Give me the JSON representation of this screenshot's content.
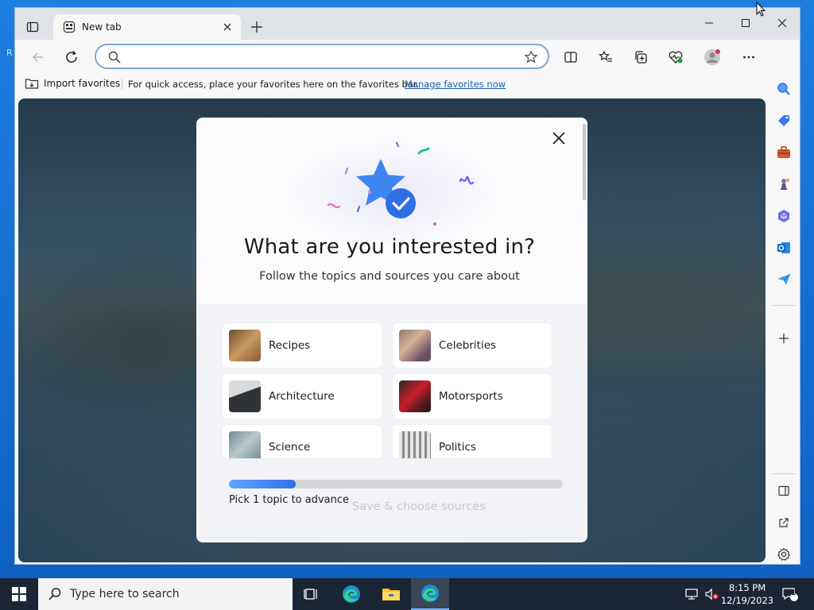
{
  "desktop": {
    "edge_letter": "R"
  },
  "browser": {
    "tab": {
      "title": "New tab"
    },
    "address": {
      "placeholder": "",
      "value": ""
    },
    "favorites_bar": {
      "import_label": "Import favorites",
      "message": "For quick access, place your favorites here on the favorites bar.",
      "manage_link": "Manage favorites now"
    }
  },
  "modal": {
    "title": "What are you interested in?",
    "subtitle": "Follow the topics and sources you care about",
    "topics": [
      {
        "label": "Recipes",
        "thumb_color": "#b08050"
      },
      {
        "label": "Celebrities",
        "thumb_color": "#a08a70"
      },
      {
        "label": "Architecture",
        "thumb_color": "#4a4f55"
      },
      {
        "label": "Motorsports",
        "thumb_color": "#b02028"
      },
      {
        "label": "Science",
        "thumb_color": "#8fa3a8"
      },
      {
        "label": "Politics",
        "thumb_color": "#9a9a9a"
      }
    ],
    "progress": {
      "label": "Pick 1 topic to advance",
      "fraction": 0.2
    },
    "save_label": "Save & choose sources"
  },
  "taskbar": {
    "search_placeholder": "Type here to search",
    "time": "8:15 PM",
    "date": "12/19/2023",
    "notification_count": "1"
  },
  "colors": {
    "accent": "#2f71e8",
    "taskbar": "#1c2534",
    "desktop": "#1a78d6"
  }
}
